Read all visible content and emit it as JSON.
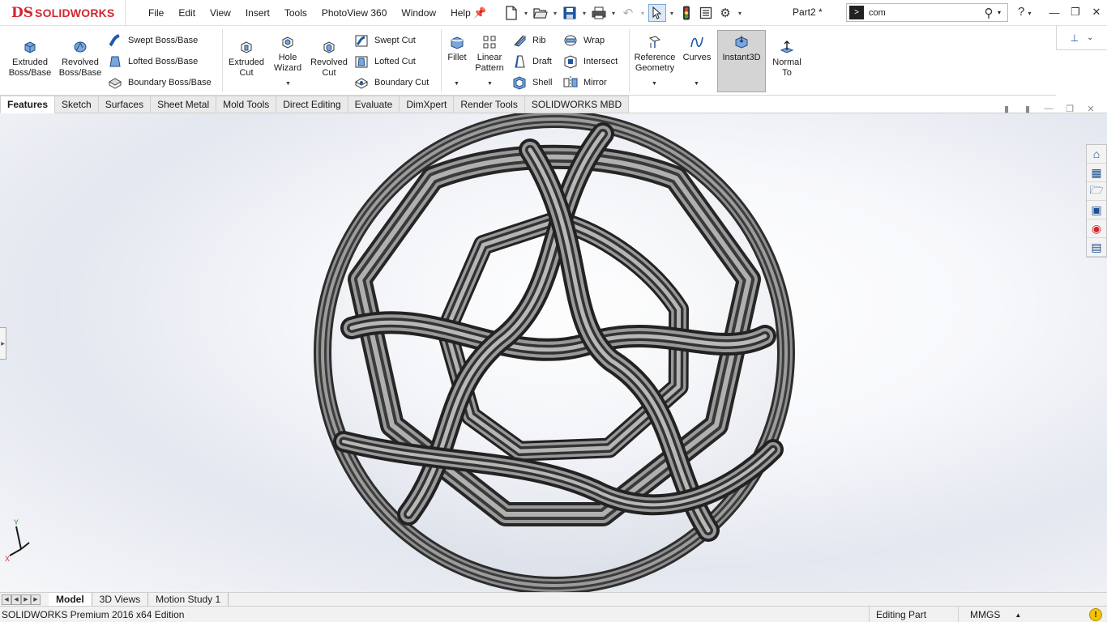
{
  "app": {
    "logo_ds": "DS",
    "logo_text": "SOLIDWORKS",
    "document_title": "Part2 *"
  },
  "menu": [
    "File",
    "Edit",
    "View",
    "Insert",
    "Tools",
    "PhotoView 360",
    "Window",
    "Help"
  ],
  "quick_access_icons": [
    "new-document-icon",
    "open-folder-icon",
    "save-icon",
    "print-icon",
    "undo-icon",
    "select-arrow-icon",
    "traffic-light-icon",
    "file-properties-icon",
    "options-gear-icon"
  ],
  "search": {
    "value": "com",
    "terminal_glyph": ">"
  },
  "ribbon": {
    "extruded_boss": [
      "Extruded",
      "Boss/Base"
    ],
    "revolved_boss": [
      "Revolved",
      "Boss/Base"
    ],
    "swept_boss": "Swept Boss/Base",
    "lofted_boss": "Lofted Boss/Base",
    "boundary_boss": "Boundary Boss/Base",
    "extruded_cut": [
      "Extruded",
      "Cut"
    ],
    "hole_wizard": [
      "Hole",
      "Wizard"
    ],
    "revolved_cut": [
      "Revolved",
      "Cut"
    ],
    "swept_cut": "Swept Cut",
    "lofted_cut": "Lofted Cut",
    "boundary_cut": "Boundary Cut",
    "fillet": "Fillet",
    "linear_pattern": [
      "Linear",
      "Pattern"
    ],
    "rib": "Rib",
    "draft": "Draft",
    "shell": "Shell",
    "wrap": "Wrap",
    "intersect": "Intersect",
    "mirror": "Mirror",
    "reference_geometry": [
      "Reference",
      "Geometry"
    ],
    "curves": "Curves",
    "instant3d": "Instant3D",
    "normal_to": [
      "Normal",
      "To"
    ]
  },
  "tabs": [
    "Features",
    "Sketch",
    "Surfaces",
    "Sheet Metal",
    "Mold Tools",
    "Direct Editing",
    "Evaluate",
    "DimXpert",
    "Render Tools",
    "SOLIDWORKS MBD"
  ],
  "triad": {
    "y": "Y",
    "x": "X"
  },
  "bottom_tabs": [
    "Model",
    "3D Views",
    "Motion Study 1"
  ],
  "status": {
    "left": "SOLIDWORKS Premium 2016 x64 Edition",
    "mode": "Editing Part",
    "units": "MMGS",
    "warning": "!"
  },
  "colors": {
    "brand": "#d22630",
    "accent": "#1f5aa6",
    "model": "#4a4a4a"
  }
}
